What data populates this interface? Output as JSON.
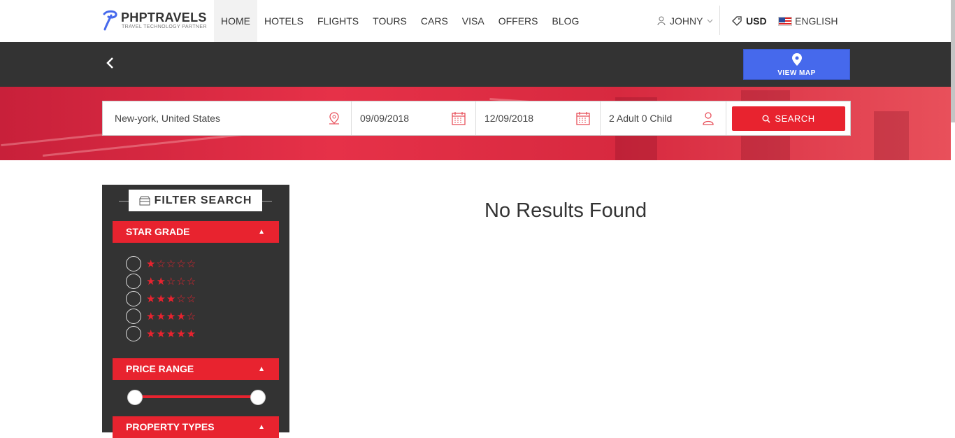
{
  "brand": {
    "name": "PHPTRAVELS",
    "tagline": "TRAVEL TECHNOLOGY PARTNER",
    "logo_icon": "logo-mark-icon"
  },
  "nav": {
    "items": [
      {
        "label": "HOME"
      },
      {
        "label": "HOTELS"
      },
      {
        "label": "FLIGHTS"
      },
      {
        "label": "TOURS"
      },
      {
        "label": "CARS"
      },
      {
        "label": "VISA"
      },
      {
        "label": "OFFERS"
      },
      {
        "label": "BLOG"
      }
    ],
    "active_index": 1
  },
  "account": {
    "user_label": "JOHNY",
    "currency": "USD",
    "language": "ENGLISH"
  },
  "map_button": {
    "label": "VIEW MAP",
    "icon": "map-pin-icon"
  },
  "search": {
    "location": "New-york, United States",
    "checkin": "09/09/2018",
    "checkout": "12/09/2018",
    "guests": "2 Adult 0 Child",
    "button_label": "SEARCH"
  },
  "filter": {
    "title": "FILTER SEARCH",
    "star_grade_label": "STAR GRADE",
    "star_options": [
      {
        "stars": "★☆☆☆☆"
      },
      {
        "stars": "★★☆☆☆"
      },
      {
        "stars": "★★★☆☆"
      },
      {
        "stars": "★★★★☆"
      },
      {
        "stars": "★★★★★"
      }
    ],
    "price_range_label": "PRICE RANGE",
    "property_types_label": "PROPERTY TYPES"
  },
  "results": {
    "message": "No Results Found"
  },
  "colors": {
    "accent": "#e8232f",
    "map_button": "#4669ec",
    "dark": "#333333"
  }
}
